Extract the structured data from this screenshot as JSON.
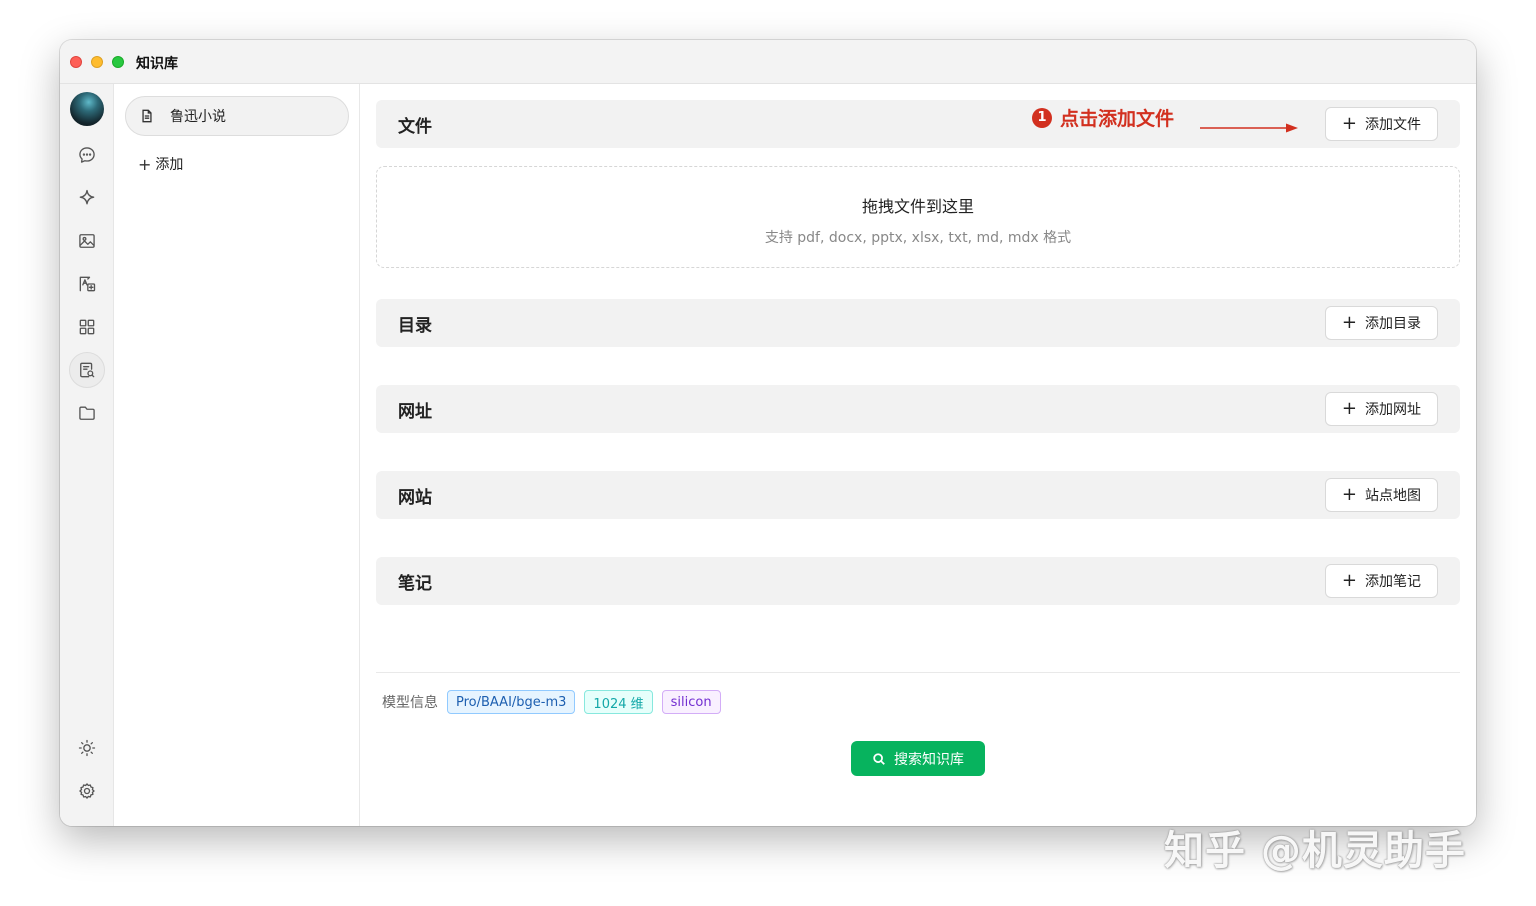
{
  "window": {
    "title": "知识库"
  },
  "rail": {
    "items": [
      {
        "icon": "chat-icon"
      },
      {
        "icon": "sparkle-icon"
      },
      {
        "icon": "image-icon"
      },
      {
        "icon": "translate-icon"
      },
      {
        "icon": "apps-grid-icon"
      },
      {
        "icon": "knowledge-base-icon",
        "active": true
      },
      {
        "icon": "folder-icon"
      }
    ],
    "bottom": [
      {
        "icon": "sun-icon"
      },
      {
        "icon": "gear-icon"
      }
    ]
  },
  "sidebar": {
    "items": [
      {
        "label": "鲁迅小说",
        "icon": "document-icon"
      }
    ],
    "add_label": "添加"
  },
  "sections": {
    "files": {
      "title": "文件",
      "button": "添加文件"
    },
    "dropzone": {
      "title": "拖拽文件到这里",
      "subtitle": "支持 pdf, docx, pptx, xlsx, txt, md, mdx 格式"
    },
    "directory": {
      "title": "目录",
      "button": "添加目录"
    },
    "url": {
      "title": "网址",
      "button": "添加网址"
    },
    "website": {
      "title": "网站",
      "button": "站点地图"
    },
    "notes": {
      "title": "笔记",
      "button": "添加笔记"
    }
  },
  "annotation": {
    "number": "1",
    "text": "点击添加文件",
    "color": "#d2301f"
  },
  "model_info": {
    "label": "模型信息",
    "tags": [
      "Pro/BAAI/bge-m3",
      "1024 维",
      "silicon"
    ]
  },
  "search_button": {
    "label": "搜索知识库",
    "color": "#07b35e"
  },
  "watermark": "知乎 @机灵助手"
}
